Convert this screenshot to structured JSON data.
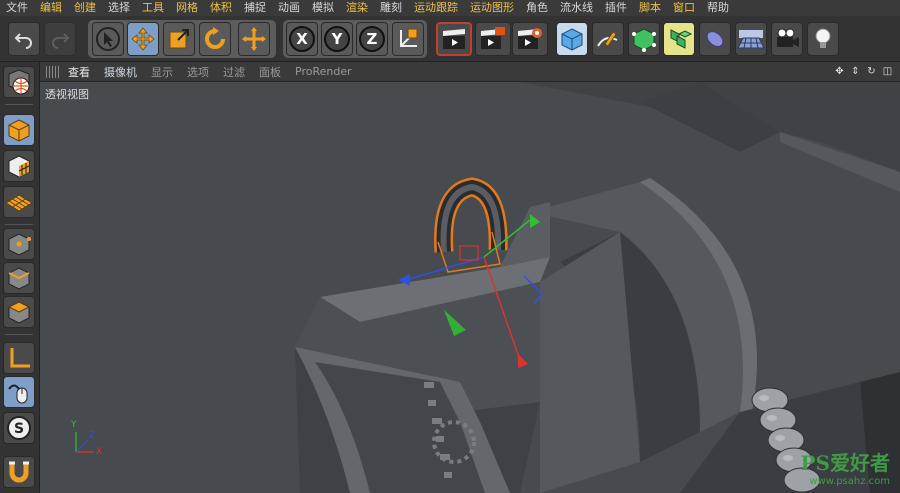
{
  "menu": {
    "items": [
      {
        "label": "文件",
        "hl": false
      },
      {
        "label": "编辑",
        "hl": true
      },
      {
        "label": "创建",
        "hl": true
      },
      {
        "label": "选择",
        "hl": false
      },
      {
        "label": "工具",
        "hl": true
      },
      {
        "label": "网格",
        "hl": true
      },
      {
        "label": "体积",
        "hl": true
      },
      {
        "label": "捕捉",
        "hl": false
      },
      {
        "label": "动画",
        "hl": false
      },
      {
        "label": "模拟",
        "hl": false
      },
      {
        "label": "渲染",
        "hl": true
      },
      {
        "label": "雕刻",
        "hl": false
      },
      {
        "label": "运动跟踪",
        "hl": true
      },
      {
        "label": "运动图形",
        "hl": true
      },
      {
        "label": "角色",
        "hl": false
      },
      {
        "label": "流水线",
        "hl": false
      },
      {
        "label": "插件",
        "hl": false
      },
      {
        "label": "脚本",
        "hl": true
      },
      {
        "label": "窗口",
        "hl": true
      },
      {
        "label": "帮助",
        "hl": false
      }
    ]
  },
  "toolbar": {
    "axis_x": "X",
    "axis_y": "Y",
    "axis_z": "Z"
  },
  "viewport_header": {
    "tabs": [
      "查看",
      "摄像机",
      "显示",
      "选项",
      "过滤",
      "面板",
      "ProRender"
    ]
  },
  "viewport": {
    "label": "透视视图",
    "axis_x": "X",
    "axis_y": "Y",
    "axis_z": "Z"
  },
  "watermark": {
    "main": "PS爱好者",
    "sub": "www.psahz.com"
  },
  "colors": {
    "highlight_menu": "#f0c040",
    "active_tool": "#7f9ec7",
    "selection_orange": "#e07a1a",
    "axis_x": "#e03030",
    "axis_y": "#30c030",
    "axis_z": "#3050e0"
  }
}
